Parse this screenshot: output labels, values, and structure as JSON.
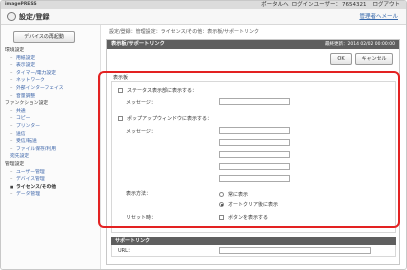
{
  "topbar": {
    "brand": "imagePRESS",
    "portal_link": "ポータルへ",
    "login_user_label": "ログインユーザー：",
    "login_user_value": "7654321",
    "logout_link": "ログアウト"
  },
  "titlebar": {
    "title": "設定/登録",
    "mail_link": "管理者へメール"
  },
  "sidebar": {
    "home_button": "デバイスの再起動",
    "items": [
      {
        "label": "環境設定",
        "type": "group"
      },
      {
        "label": "用紙設定",
        "type": "item"
      },
      {
        "label": "表示設定",
        "type": "item"
      },
      {
        "label": "タイマー/電力設定",
        "type": "item"
      },
      {
        "label": "ネットワーク",
        "type": "item"
      },
      {
        "label": "外部インターフェイス",
        "type": "item"
      },
      {
        "label": "音量調整",
        "type": "item"
      },
      {
        "label": "ファンクション設定",
        "type": "group"
      },
      {
        "label": "共通",
        "type": "item"
      },
      {
        "label": "コピー",
        "type": "item"
      },
      {
        "label": "プリンター",
        "type": "item"
      },
      {
        "label": "送信",
        "type": "item"
      },
      {
        "label": "受信/転送",
        "type": "item"
      },
      {
        "label": "ファイル保存/利用",
        "type": "item"
      },
      {
        "label": "宛先設定",
        "type": "group"
      },
      {
        "label": "管理設定",
        "type": "group"
      },
      {
        "label": "ユーザー管理",
        "type": "item"
      },
      {
        "label": "デバイス管理",
        "type": "item"
      },
      {
        "label": "ライセンス/その他",
        "type": "item",
        "active": true
      },
      {
        "label": "データ管理",
        "type": "item"
      }
    ]
  },
  "breadcrumb": "設定/登録：管理設定：ライセンス/その他：表示板/サポートリンク",
  "panel": {
    "title": "表示板/サポートリンク",
    "last_updated": "最終更新：2014 02/02 00:00:00",
    "ok_button": "OK",
    "cancel_button": "キャンセル",
    "display_section": {
      "title": "表示板",
      "status_checkbox_label": "ステータス表示部に表示する：",
      "message_label": "メッセージ：",
      "popup_checkbox_label": "ポップアップウィンドウに表示する：",
      "popup_message_label": "メッセージ：",
      "display_method_label": "表示方法：",
      "display_method_options": [
        "常に表示",
        "オートクリア後に表示"
      ],
      "display_method_selected": 1,
      "reset_label": "リセット時：",
      "reset_checkbox_label": "ボタンを表示する"
    },
    "support_section": {
      "title": "サポートリンク",
      "url_label": "URL："
    }
  }
}
